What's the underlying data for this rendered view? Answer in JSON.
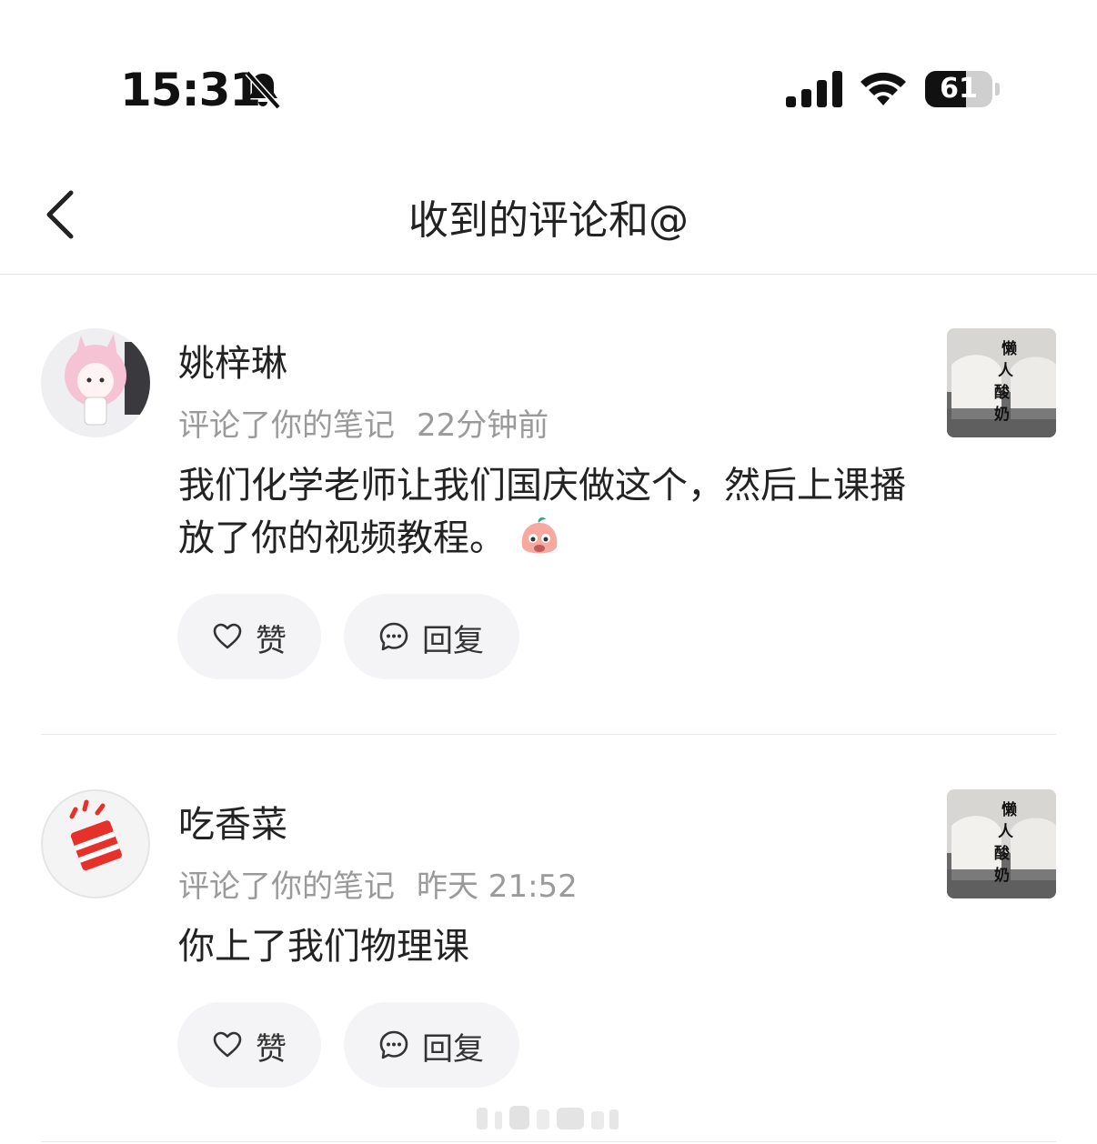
{
  "status_bar": {
    "time": "15:31",
    "battery": "61",
    "battery_level": 0.61,
    "icons": [
      "bell-slash-icon",
      "cellular-signal-icon",
      "wifi-icon",
      "battery-icon"
    ]
  },
  "nav": {
    "title": "收到的评论和@",
    "back_icon": "chevron-left-icon"
  },
  "comments": [
    {
      "username": "姚梓琳",
      "action": "评论了你的笔记",
      "time": "22分钟前",
      "text": "我们化学老师让我们国庆做这个，然后上课播放了你的视频教程。",
      "emoji": "sticker-emoji",
      "like_label": "赞",
      "reply_label": "回复",
      "thumbnail_text": [
        "懒",
        "人",
        "酸",
        "奶"
      ]
    },
    {
      "username": "吃香菜",
      "action": "评论了你的笔记",
      "time": "昨天 21:52",
      "text": "你上了我们物理课",
      "like_label": "赞",
      "reply_label": "回复",
      "thumbnail_text": [
        "懒",
        "人",
        "酸",
        "奶"
      ]
    }
  ],
  "colors": {
    "background": "#ffffff",
    "pill_bg": "#f4f4f6",
    "meta_text": "#9a9a9a",
    "divider": "#e8e8e8"
  }
}
